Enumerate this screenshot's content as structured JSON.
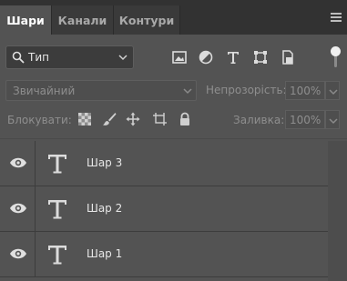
{
  "tabs": [
    {
      "label": "Шари",
      "active": true
    },
    {
      "label": "Канали",
      "active": false
    },
    {
      "label": "Контури",
      "active": false
    }
  ],
  "filter": {
    "selected": "Тип"
  },
  "filter_icons": [
    "image-icon",
    "adjustment-icon",
    "type-icon",
    "shape-icon",
    "smart-object-icon"
  ],
  "blend": {
    "mode": "Звичайний",
    "opacity_label": "Непрозорість:",
    "opacity_value": "100%"
  },
  "lock": {
    "label": "Блокувати:",
    "fill_label": "Заливка:",
    "fill_value": "100%"
  },
  "layers": [
    {
      "name": "Шар 3",
      "visible": true,
      "type": "text"
    },
    {
      "name": "Шар 2",
      "visible": true,
      "type": "text"
    },
    {
      "name": "Шар 1",
      "visible": true,
      "type": "text"
    }
  ],
  "colors": {
    "panel_bg": "#535353",
    "tab_bar_bg": "#323232",
    "text": "#e6e6e6",
    "disabled_text": "#8e8e8e"
  }
}
